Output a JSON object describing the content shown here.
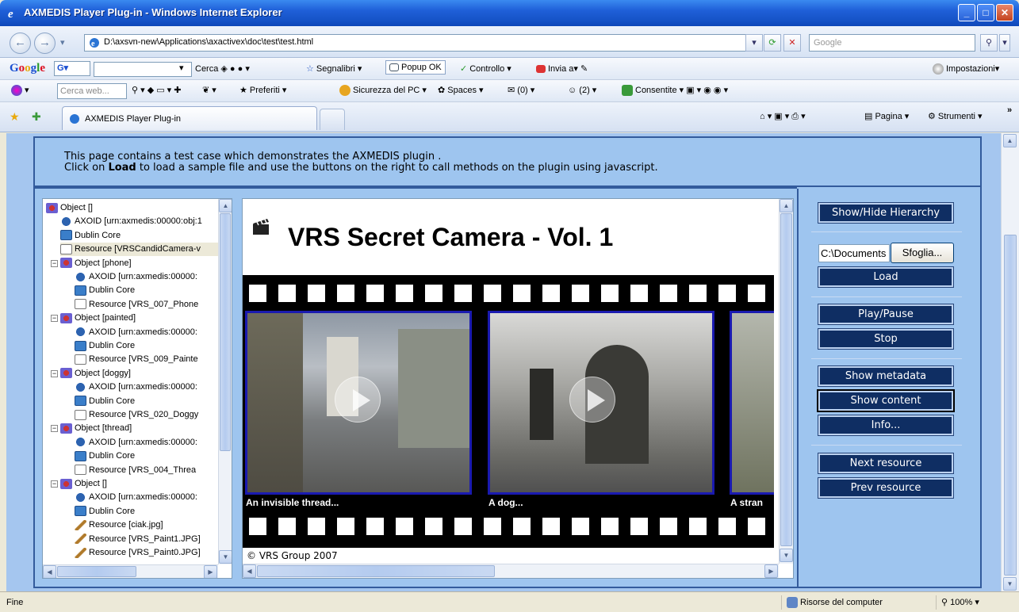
{
  "window": {
    "title": "AXMEDIS Player Plug-in - Windows Internet Explorer"
  },
  "address": {
    "url": "D:\\axsvn-new\\Applications\\axactivex\\doc\\test\\test.html",
    "search_placeholder": "Google"
  },
  "google_toolbar": {
    "logo": "Google",
    "items": [
      "Cerca",
      "Segnalibri",
      "Popup OK",
      "Controllo",
      "Invia a"
    ],
    "settings": "Impostazioni"
  },
  "msn_toolbar": {
    "search_placeholder": "Cerca web...",
    "items": [
      "Preferiti",
      "Sicurezza del PC",
      "Spaces",
      "(0)",
      "(2)",
      "Consentite"
    ]
  },
  "tabs": {
    "active": "AXMEDIS Player Plug-in",
    "right_items": [
      "Pagina",
      "Strumenti"
    ]
  },
  "page": {
    "intro_line1": "This page contains a test case which demonstrates the AXMEDIS plugin .",
    "intro_line2_pre": "Click on ",
    "intro_line2_bold": "Load",
    "intro_line2_post": " to load a sample file and use the buttons on the right to call methods on the plugin using javascript."
  },
  "tree": [
    {
      "label": "Object []",
      "icon": "object-icon",
      "indent": 0
    },
    {
      "label": "AXOID [urn:axmedis:00000:obj:1",
      "icon": "axoid-icon",
      "indent": 1
    },
    {
      "label": "Dublin Core",
      "icon": "dublin-core-icon",
      "indent": 1
    },
    {
      "label": "Resource [VRSCandidCamera-v",
      "icon": "resource-icon",
      "indent": 1
    },
    {
      "label": "Object [phone]",
      "icon": "object-icon",
      "indent": 1
    },
    {
      "label": "AXOID [urn:axmedis:00000:",
      "icon": "axoid-icon",
      "indent": 2
    },
    {
      "label": "Dublin Core",
      "icon": "dublin-core-icon",
      "indent": 2
    },
    {
      "label": "Resource [VRS_007_Phone",
      "icon": "resource-icon",
      "indent": 2
    },
    {
      "label": "Object [painted]",
      "icon": "object-icon",
      "indent": 1
    },
    {
      "label": "AXOID [urn:axmedis:00000:",
      "icon": "axoid-icon",
      "indent": 2
    },
    {
      "label": "Dublin Core",
      "icon": "dublin-core-icon",
      "indent": 2
    },
    {
      "label": "Resource [VRS_009_Painte",
      "icon": "resource-icon",
      "indent": 2
    },
    {
      "label": "Object [doggy]",
      "icon": "object-icon",
      "indent": 1
    },
    {
      "label": "AXOID [urn:axmedis:00000:",
      "icon": "axoid-icon",
      "indent": 2
    },
    {
      "label": "Dublin Core",
      "icon": "dublin-core-icon",
      "indent": 2
    },
    {
      "label": "Resource [VRS_020_Doggy",
      "icon": "resource-icon",
      "indent": 2
    },
    {
      "label": "Object [thread]",
      "icon": "object-icon",
      "indent": 1
    },
    {
      "label": "AXOID [urn:axmedis:00000:",
      "icon": "axoid-icon",
      "indent": 2
    },
    {
      "label": "Dublin Core",
      "icon": "dublin-core-icon",
      "indent": 2
    },
    {
      "label": "Resource [VRS_004_Threa",
      "icon": "resource-icon",
      "indent": 2
    },
    {
      "label": "Object []",
      "icon": "object-icon",
      "indent": 1
    },
    {
      "label": "AXOID [urn:axmedis:00000:",
      "icon": "axoid-icon",
      "indent": 2
    },
    {
      "label": "Dublin Core",
      "icon": "dublin-core-icon",
      "indent": 2
    },
    {
      "label": "Resource [ciak.jpg]",
      "icon": "image-resource-icon",
      "indent": 2
    },
    {
      "label": "Resource [VRS_Paint1.JPG]",
      "icon": "image-resource-icon",
      "indent": 2
    },
    {
      "label": "Resource [VRS_Paint0.JPG]",
      "icon": "image-resource-icon",
      "indent": 2
    }
  ],
  "viewer": {
    "title": "VRS Secret Camera - Vol. 1",
    "captions": [
      "An invisible thread...",
      "A dog...",
      "A stran"
    ],
    "copyright": "© VRS Group 2007"
  },
  "controls": {
    "show_hide_hierarchy": "Show/Hide Hierarchy",
    "file_value": "C:\\Documents",
    "browse": "Sfoglia...",
    "load": "Load",
    "play_pause": "Play/Pause",
    "stop": "Stop",
    "show_metadata": "Show metadata",
    "show_content": "Show content",
    "info": "Info...",
    "next_resource": "Next resource",
    "prev_resource": "Prev resource"
  },
  "status": {
    "left": "Fine",
    "zone": "Risorse del computer",
    "zoom": "100%"
  }
}
